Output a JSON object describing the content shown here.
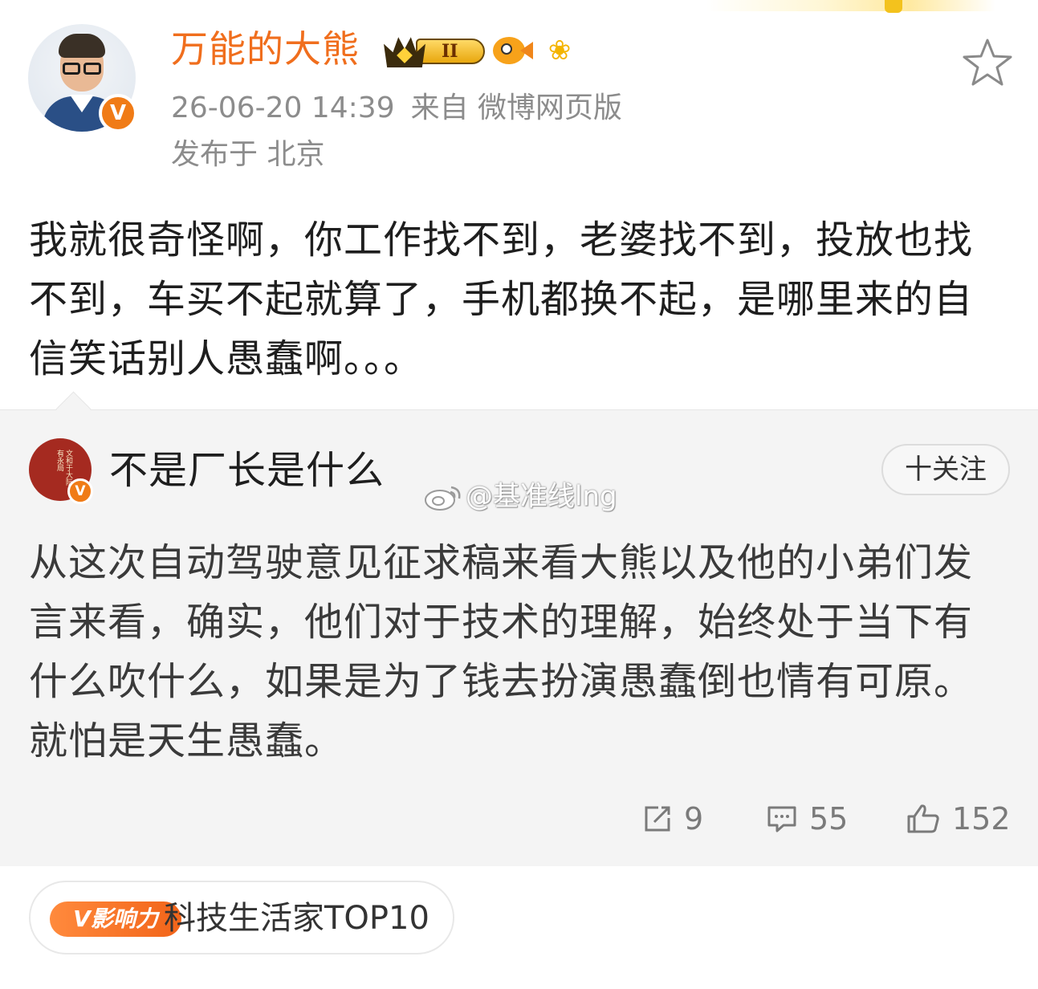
{
  "post": {
    "author": "万能的大熊",
    "level_badge": "II",
    "timestamp": "26-06-20 14:39",
    "source": "来自 微博网页版",
    "location": "发布于 北京",
    "text": "我就很奇怪啊，你工作找不到，老婆找不到，投放也找不到，车买不起就算了，手机都换不起，是哪里来的自信笑话别人愚蠢啊。。。",
    "verified_mark": "V"
  },
  "quoted": {
    "author": "不是厂长是什么",
    "avatar_seal_text": "文和于大阮有永局",
    "verified_mark": "V",
    "follow_label": "十关注",
    "watermark": "@基准线lng",
    "text": "从这次自动驾驶意见征求稿来看大熊以及他的小弟们发言来看，确实，他们对于技术的理解，始终处于当下有什么吹什么，如果是为了钱去扮演愚蠢倒也情有可原。就怕是天生愚蠢。",
    "stats": {
      "reposts": "9",
      "comments": "55",
      "likes": "152"
    }
  },
  "influence": {
    "badge": "V影响力",
    "label": "科技生活家TOP10"
  },
  "colors": {
    "username": "#f06e1d",
    "verified": "#f07b16",
    "meta": "#8c8c8c",
    "quote_bg": "#f4f4f4"
  },
  "icons": [
    "favorite-star-icon",
    "repost-icon",
    "comment-icon",
    "like-icon",
    "weibo-logo-icon",
    "crown-icon",
    "fish-icon",
    "flower-icon"
  ]
}
